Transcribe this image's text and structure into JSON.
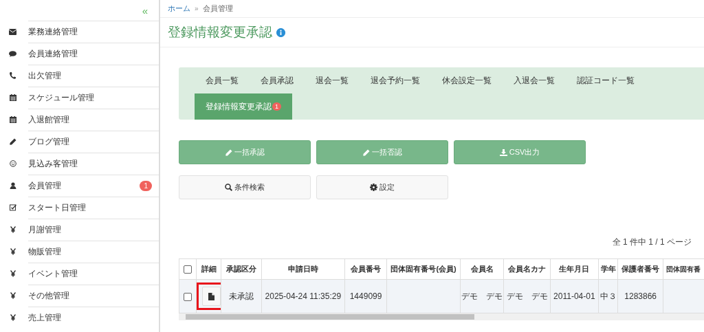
{
  "sidebar": {
    "collapse_label": "«",
    "items": [
      {
        "label": "業務連絡管理",
        "kind": "envelope"
      },
      {
        "label": "会員連絡管理",
        "kind": "bubble"
      },
      {
        "label": "出欠管理",
        "kind": "phone"
      },
      {
        "label": "スケジュール管理",
        "kind": "calendar"
      },
      {
        "label": "入退館管理",
        "kind": "calendar"
      },
      {
        "label": "ブログ管理",
        "kind": "pencil"
      },
      {
        "label": "見込み客管理",
        "kind": "smiley"
      },
      {
        "label": "会員管理",
        "kind": "person",
        "badge": "1"
      },
      {
        "label": "スタート日管理",
        "kind": "checkbox"
      },
      {
        "label": "月謝管理",
        "kind": "yen"
      },
      {
        "label": "物販管理",
        "kind": "yen"
      },
      {
        "label": "イベント管理",
        "kind": "yen"
      },
      {
        "label": "その他管理",
        "kind": "yen"
      },
      {
        "label": "売上管理",
        "kind": "yen"
      }
    ]
  },
  "breadcrumb": {
    "separator": "»",
    "items": [
      {
        "label": "ホーム",
        "kind": "link"
      },
      {
        "label": "会員管理",
        "kind": "current"
      }
    ]
  },
  "page_title": "登録情報変更承認",
  "tabs": [
    {
      "label": "会員一覧",
      "selected": false
    },
    {
      "label": "会員承認",
      "selected": false
    },
    {
      "label": "退会一覧",
      "selected": false
    },
    {
      "label": "退会予約一覧",
      "selected": false
    },
    {
      "label": "休会設定一覧",
      "selected": false
    },
    {
      "label": "入退会一覧",
      "selected": false
    },
    {
      "label": "認証コード一覧",
      "selected": false
    },
    {
      "label": "登録情報変更承認",
      "selected": true,
      "badge": "1"
    }
  ],
  "buttons": [
    {
      "label": "一括承認",
      "kind": "pencil",
      "primary": true
    },
    {
      "label": "一括否認",
      "kind": "pencil",
      "primary": true
    },
    {
      "label": "CSV出力",
      "kind": "download",
      "primary": true
    },
    {
      "label": "条件検索",
      "kind": "search",
      "primary": false
    },
    {
      "label": "設定",
      "kind": "gear",
      "primary": false
    }
  ],
  "pagination": "全 1 件中 1 / 1 ページ",
  "table": {
    "columns": [
      "詳細",
      "承認区分",
      "申請日時",
      "会員番号",
      "団体固有番号(会員)",
      "会員名",
      "会員名カナ",
      "生年月日",
      "学年",
      "保護者番号",
      "団体固有番"
    ],
    "header_checked": false,
    "rows": [
      {
        "checked": false,
        "detail_highlighted": true,
        "cells": [
          "",
          "未承認",
          "2025-04-24 11:35:29",
          "1449099",
          "",
          "デモ　デモ",
          "デモ　デモ",
          "2011-04-01",
          "中３",
          "1283866",
          ""
        ]
      }
    ]
  }
}
